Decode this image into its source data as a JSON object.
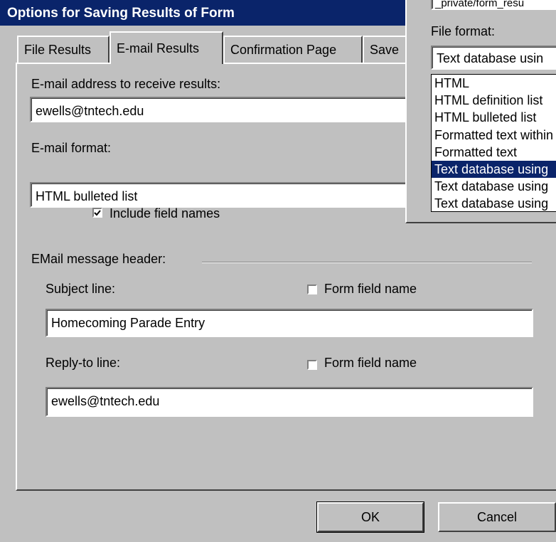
{
  "window": {
    "title": "Options for Saving Results of Form"
  },
  "tabs": [
    {
      "label": "File Results",
      "active": false
    },
    {
      "label": "E-mail Results",
      "active": true
    },
    {
      "label": "Confirmation Page",
      "active": false
    },
    {
      "label": "Save",
      "active": false
    }
  ],
  "email": {
    "address_label": "E-mail address to receive results:",
    "address_value": "ewells@tntech.edu",
    "format_label": "E-mail format:",
    "format_value": "HTML bulleted list",
    "include_field_names_label": "Include field names",
    "include_field_names_checked": true
  },
  "header": {
    "group_label": "EMail message header:",
    "subject_label": "Subject line:",
    "subject_form_field_label": "Form field name",
    "subject_form_field_checked": false,
    "subject_value": "Homecoming Parade Entry",
    "replyto_label": "Reply-to line:",
    "replyto_form_field_label": "Form field name",
    "replyto_form_field_checked": false,
    "replyto_value": "ewells@tntech.edu"
  },
  "buttons": {
    "ok": "OK",
    "cancel": "Cancel"
  },
  "file_format_popup": {
    "path_fragment": "_private/form_resu",
    "label": "File format:",
    "selected_value": "Text database usin",
    "options": [
      "HTML",
      "HTML definition list",
      "HTML bulleted list",
      "Formatted text within",
      "Formatted text",
      "Text database using",
      "Text database using",
      "Text database using"
    ],
    "selected_index": 5
  },
  "colors": {
    "titlebar": "#0a246a",
    "face": "#c0c0c0",
    "highlight": "#0a246a"
  }
}
